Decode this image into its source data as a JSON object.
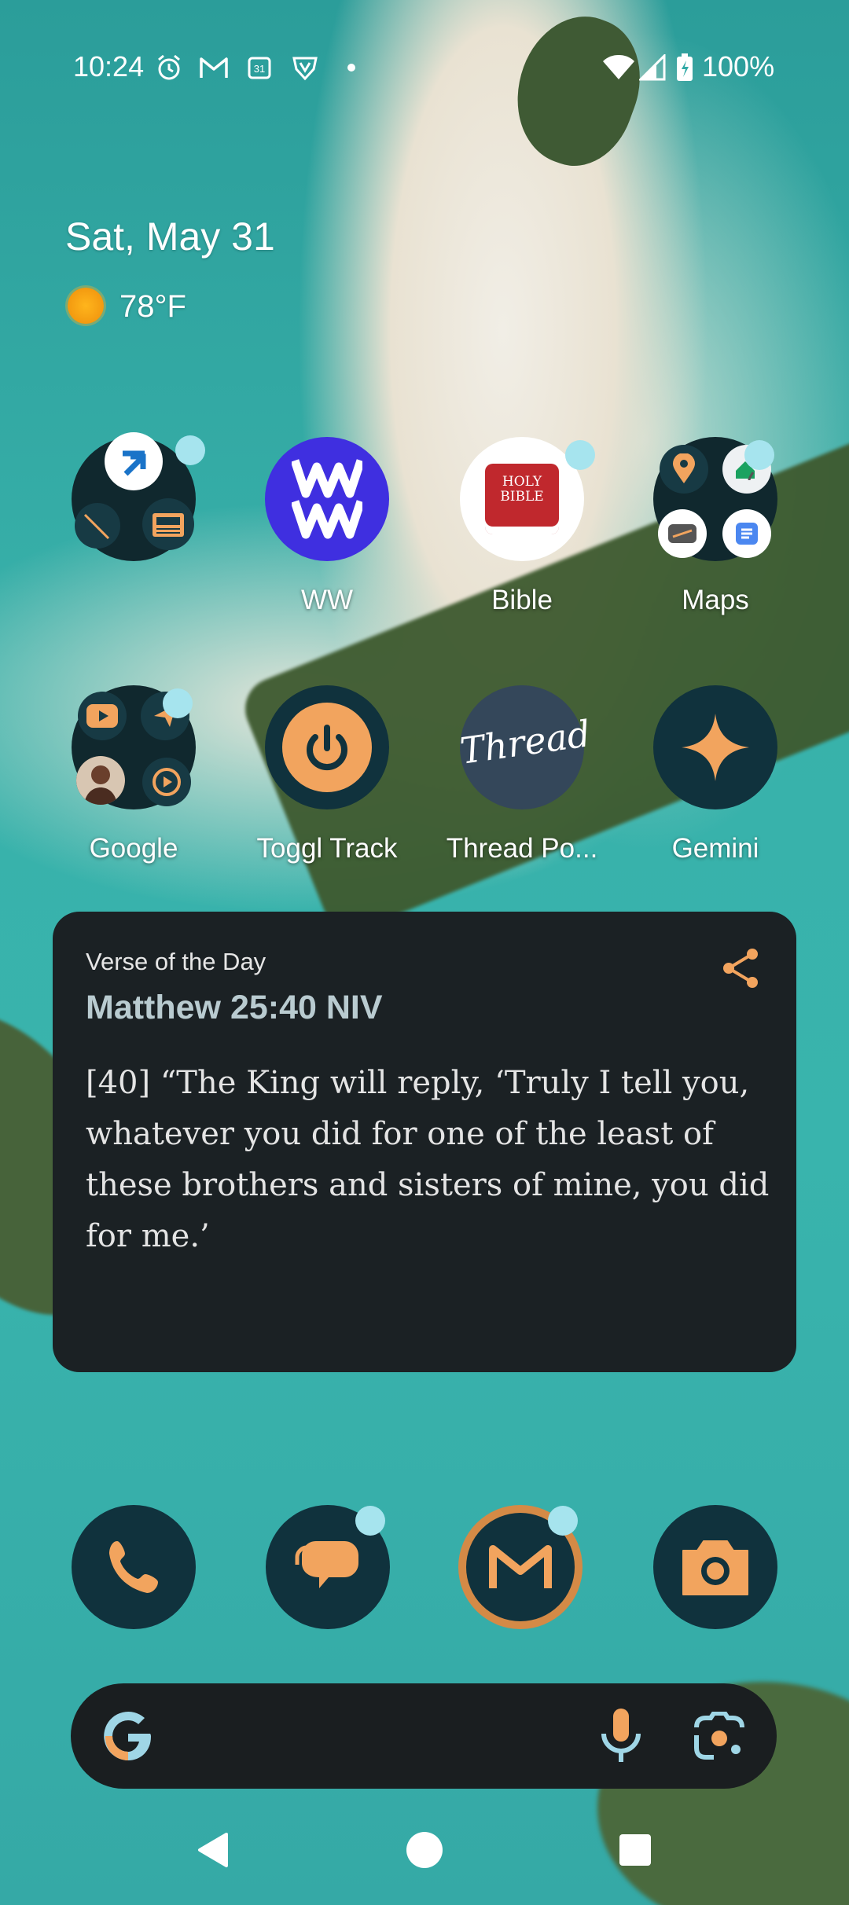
{
  "status_bar": {
    "time": "10:24",
    "notification_icons": [
      "alarm-icon",
      "gmail-icon",
      "calendar-icon",
      "vpn-shield-icon",
      "more-dot-icon"
    ],
    "calendar_day": "31",
    "system_icons": [
      "wifi-icon",
      "signal-icon",
      "battery-charging-icon"
    ],
    "battery": "100%"
  },
  "glance": {
    "date": "Sat, May 31",
    "temperature": "78°F",
    "weather_icon": "sunny-icon"
  },
  "home_rows": [
    [
      {
        "label": "",
        "type": "folder"
      },
      {
        "label": "WW"
      },
      {
        "label": "Bible",
        "icon_text": "HOLY BIBLE"
      },
      {
        "label": "Maps",
        "type": "folder"
      }
    ],
    [
      {
        "label": "Google",
        "type": "folder"
      },
      {
        "label": "Toggl Track"
      },
      {
        "label": "Thread Po...",
        "icon_text": "Thread"
      },
      {
        "label": "Gemini"
      }
    ]
  ],
  "ww_icon_text": "WW",
  "widget": {
    "title": "Verse of the Day",
    "reference": "Matthew 25:40 NIV",
    "verse": "[40]  “The King will reply, ‘Truly I tell you, whatever you did for one of the least of these brothers and sisters of mine, you did for me.’"
  },
  "dock": [
    "phone-icon",
    "messages-icon",
    "gmail-icon",
    "camera-icon"
  ],
  "search_bar": {
    "logo": "google-g-icon",
    "mic": "mic-icon",
    "lens": "lens-icon"
  },
  "navigation": [
    "back-icon",
    "home-icon",
    "recents-icon"
  ],
  "colors": {
    "accent": "#f2a45e",
    "dock_bg": "#10323d",
    "widget_bg": "#1b2124",
    "badge": "#a6e4ee"
  }
}
